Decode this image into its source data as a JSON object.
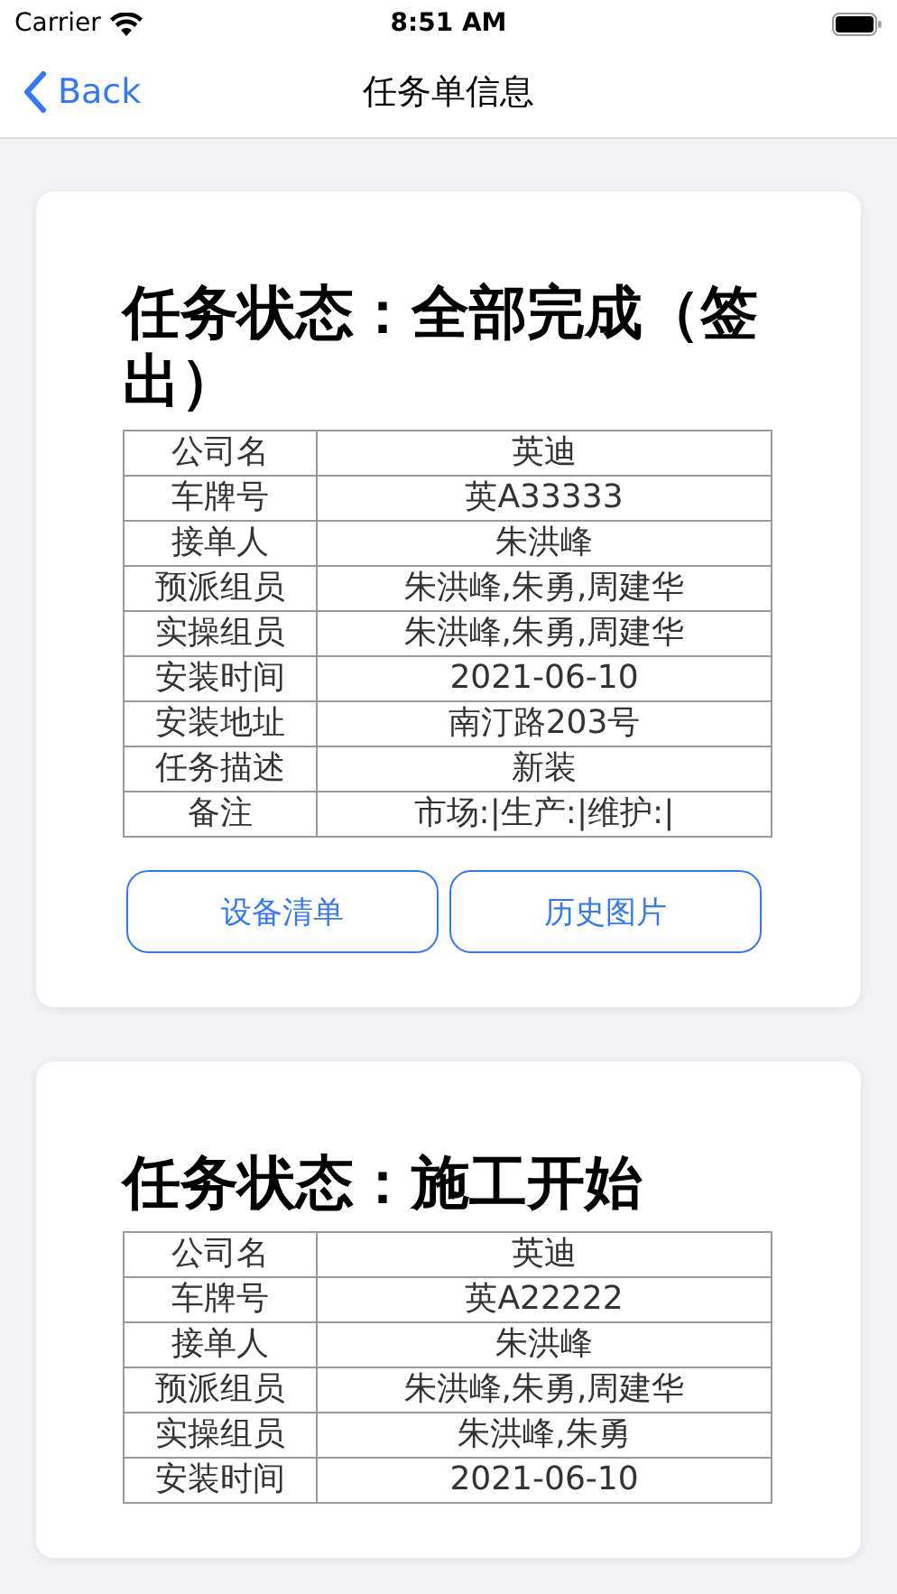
{
  "status_bar": {
    "carrier": "Carrier",
    "time": "8:51 AM"
  },
  "nav": {
    "back": "Back",
    "title": "任务单信息"
  },
  "tasks": [
    {
      "status": "任务状态：全部完成（签出）",
      "rows": [
        {
          "label": "公司名",
          "value": "英迪"
        },
        {
          "label": "车牌号",
          "value": "英A33333"
        },
        {
          "label": "接单人",
          "value": "朱洪峰"
        },
        {
          "label": "预派组员",
          "value": "朱洪峰,朱勇,周建华"
        },
        {
          "label": "实操组员",
          "value": "朱洪峰,朱勇,周建华"
        },
        {
          "label": "安装时间",
          "value": "2021-06-10"
        },
        {
          "label": "安装地址",
          "value": "南汀路203号"
        },
        {
          "label": "任务描述",
          "value": "新装"
        },
        {
          "label": "备注",
          "value": "市场:|生产:|维护:|"
        }
      ],
      "buttons": [
        "设备清单",
        "历史图片"
      ]
    },
    {
      "status": "任务状态：施工开始",
      "rows": [
        {
          "label": "公司名",
          "value": "英迪"
        },
        {
          "label": "车牌号",
          "value": "英A22222"
        },
        {
          "label": "接单人",
          "value": "朱洪峰"
        },
        {
          "label": "预派组员",
          "value": "朱洪峰,朱勇,周建华"
        },
        {
          "label": "实操组员",
          "value": "朱洪峰,朱勇"
        },
        {
          "label": "安装时间",
          "value": "2021-06-10"
        }
      ]
    }
  ]
}
